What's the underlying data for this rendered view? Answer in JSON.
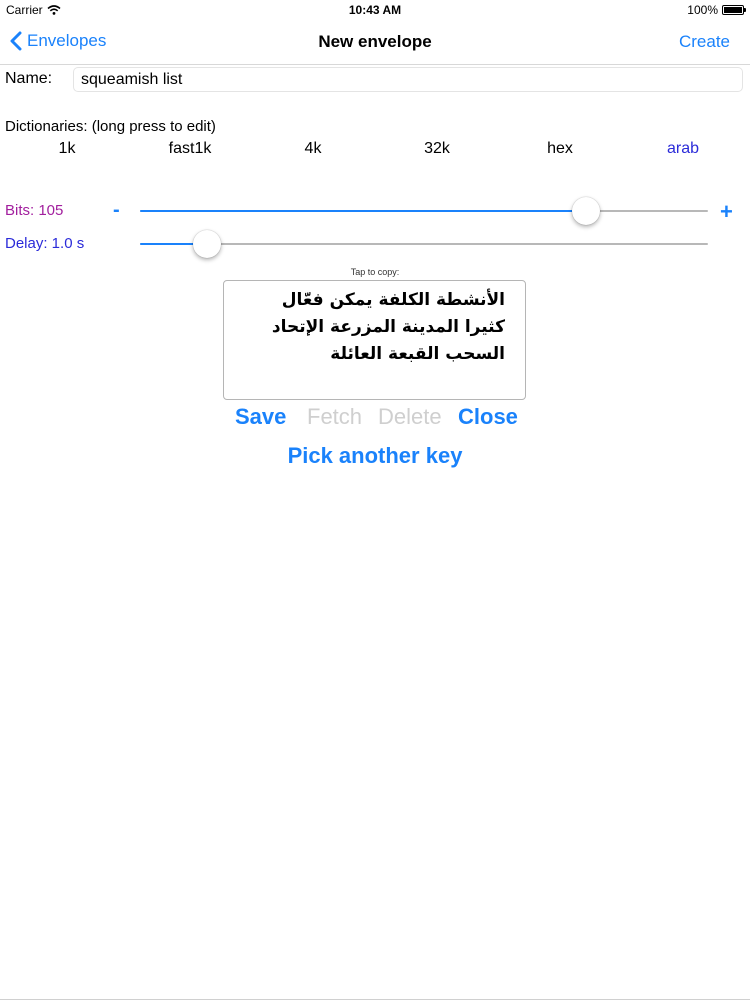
{
  "status_bar": {
    "carrier": "Carrier",
    "time": "10:43 AM",
    "battery": "100%",
    "battery_level": 1.0
  },
  "nav": {
    "back_label": "Envelopes",
    "title": "New envelope",
    "action_label": "Create"
  },
  "name_field": {
    "label": "Name:",
    "value": "squeamish list"
  },
  "dictionaries": {
    "label": "Dictionaries:  (long press to edit)",
    "items": [
      "1k",
      "fast1k",
      "4k",
      "32k",
      "hex",
      "arab"
    ],
    "selected": "arab"
  },
  "bits": {
    "label": "Bits: 105",
    "minus": "-",
    "plus": "+",
    "level": 0.785
  },
  "delay": {
    "label": "Delay: 1.0 s",
    "level": 0.118
  },
  "key_box": {
    "hint": "Tap to copy:",
    "text": "الأنشطة الكلفة يمكن فعّال كثيرا المدينة المزرعة الإتحاد السحب القبعة العائلة"
  },
  "actions": {
    "save": "Save",
    "fetch": "Fetch",
    "delete": "Delete",
    "close": "Close",
    "pick_another": "Pick another key"
  },
  "colors": {
    "accent": "#1a82fb",
    "bits_label": "#a21f9e",
    "delay_label": "#2b2bd9",
    "selected_dictionary": "#2b2bd9",
    "disabled": "#cfcfcf"
  }
}
